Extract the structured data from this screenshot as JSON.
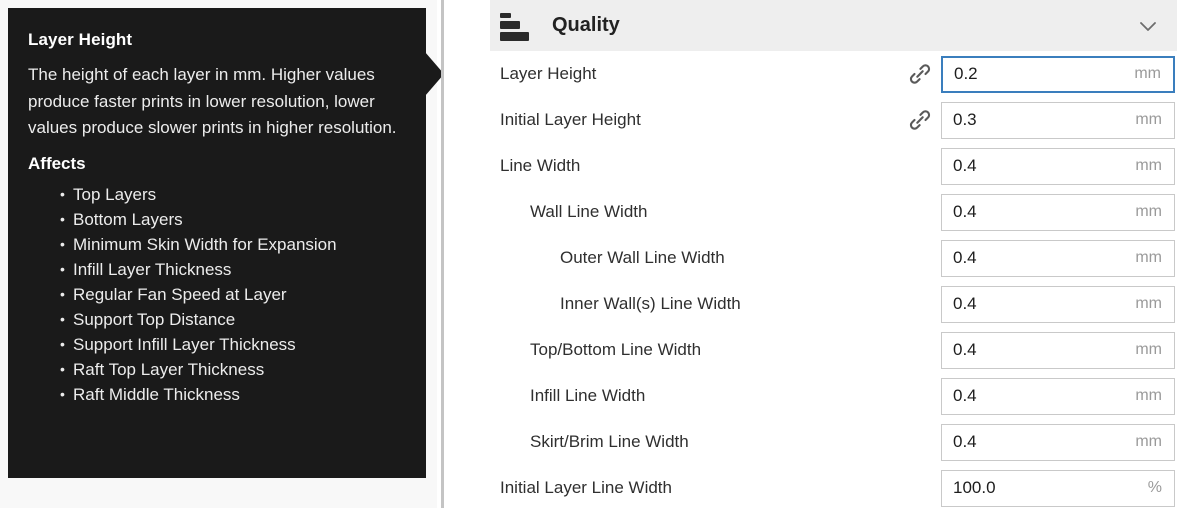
{
  "tooltip": {
    "title": "Layer Height",
    "description": "The height of each layer in mm. Higher values produce faster prints in lower resolution, lower values produce slower prints in higher resolution.",
    "affects_heading": "Affects",
    "affects": [
      "Top Layers",
      "Bottom Layers",
      "Minimum Skin Width for Expansion",
      "Infill Layer Thickness",
      "Regular Fan Speed at Layer",
      "Support Top Distance",
      "Support Infill Layer Thickness",
      "Raft Top Layer Thickness",
      "Raft Middle Thickness"
    ]
  },
  "panel": {
    "category_title": "Quality",
    "category_icon": "layers-stack-icon",
    "collapse_icon": "chevron-down-icon",
    "link_icon": "link-chain-icon",
    "focus_color": "#3a7ebd",
    "header_bg": "#eeeeee",
    "settings": [
      {
        "label": "Layer Height",
        "indent": 0,
        "value": "0.2",
        "unit": "mm",
        "linked": true,
        "focused": true
      },
      {
        "label": "Initial Layer Height",
        "indent": 0,
        "value": "0.3",
        "unit": "mm",
        "linked": true,
        "focused": false
      },
      {
        "label": "Line Width",
        "indent": 0,
        "value": "0.4",
        "unit": "mm",
        "linked": false,
        "focused": false
      },
      {
        "label": "Wall Line Width",
        "indent": 1,
        "value": "0.4",
        "unit": "mm",
        "linked": false,
        "focused": false
      },
      {
        "label": "Outer Wall Line Width",
        "indent": 2,
        "value": "0.4",
        "unit": "mm",
        "linked": false,
        "focused": false
      },
      {
        "label": "Inner Wall(s) Line Width",
        "indent": 2,
        "value": "0.4",
        "unit": "mm",
        "linked": false,
        "focused": false
      },
      {
        "label": "Top/Bottom Line Width",
        "indent": 1,
        "value": "0.4",
        "unit": "mm",
        "linked": false,
        "focused": false
      },
      {
        "label": "Infill Line Width",
        "indent": 1,
        "value": "0.4",
        "unit": "mm",
        "linked": false,
        "focused": false
      },
      {
        "label": "Skirt/Brim Line Width",
        "indent": 1,
        "value": "0.4",
        "unit": "mm",
        "linked": false,
        "focused": false
      },
      {
        "label": "Initial Layer Line Width",
        "indent": 0,
        "value": "100.0",
        "unit": "%",
        "linked": false,
        "focused": false
      }
    ]
  }
}
